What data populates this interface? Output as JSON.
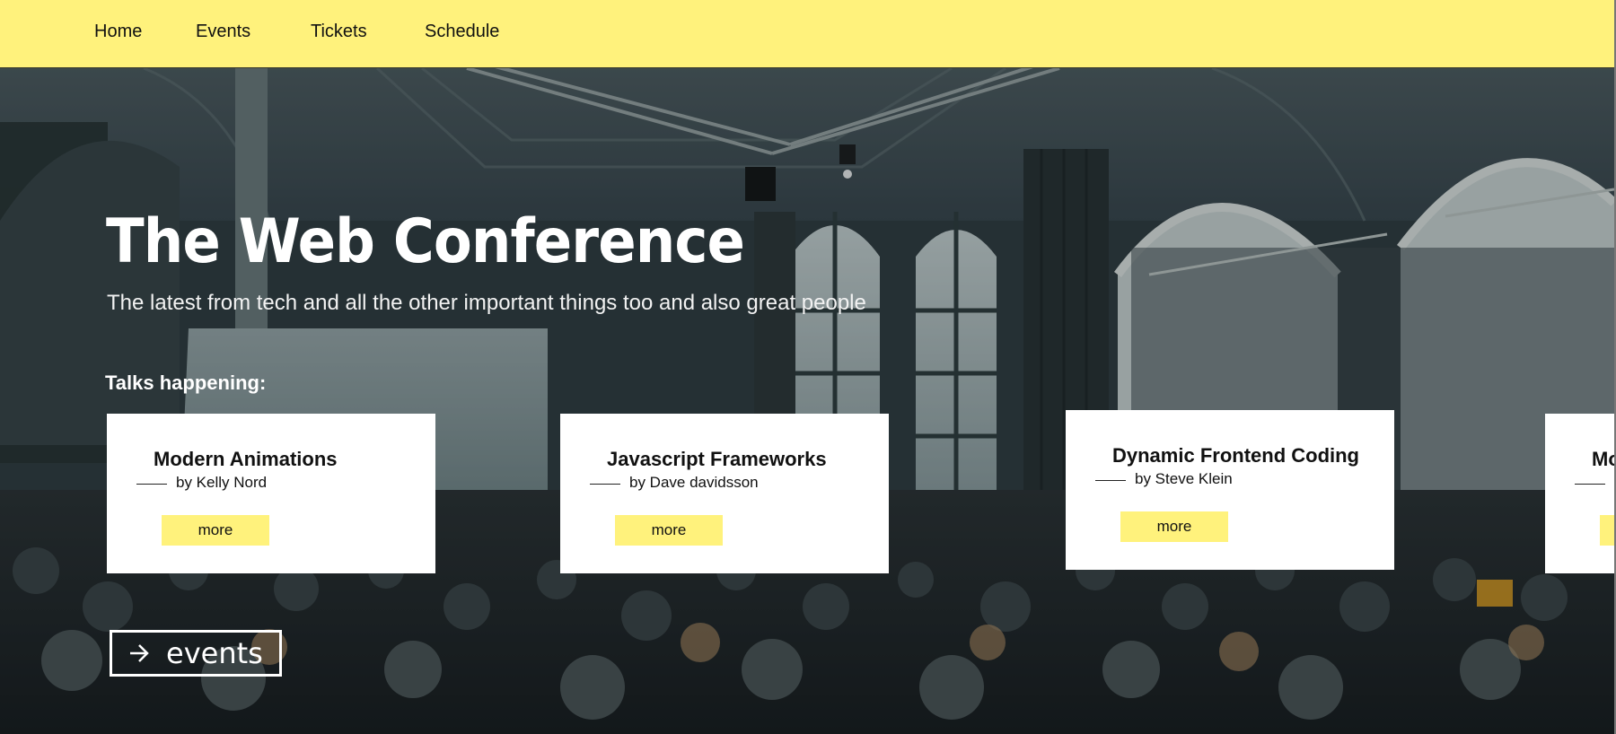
{
  "nav": {
    "items": [
      {
        "label": "Home"
      },
      {
        "label": "Events"
      },
      {
        "label": "Tickets"
      },
      {
        "label": "Schedule"
      }
    ]
  },
  "hero": {
    "title": "The Web Conference",
    "subtitle": "The latest from tech and all the other important things too and also great people",
    "talks_heading": "Talks happening:"
  },
  "talks": [
    {
      "title": "Modern Animations",
      "author": "by Kelly Nord",
      "button": "more"
    },
    {
      "title": "Javascript Frameworks",
      "author": "by Dave davidsson",
      "button": "more"
    },
    {
      "title": "Dynamic Frontend Coding",
      "author": "by Steve Klein",
      "button": "more"
    },
    {
      "title": "Mo",
      "author": "",
      "button": ""
    }
  ],
  "events_button": {
    "label": "events",
    "icon": "arrow-right-icon"
  },
  "colors": {
    "accent": "#fff27c",
    "hero_overlay": "#2c3438",
    "card_bg": "#ffffff"
  }
}
